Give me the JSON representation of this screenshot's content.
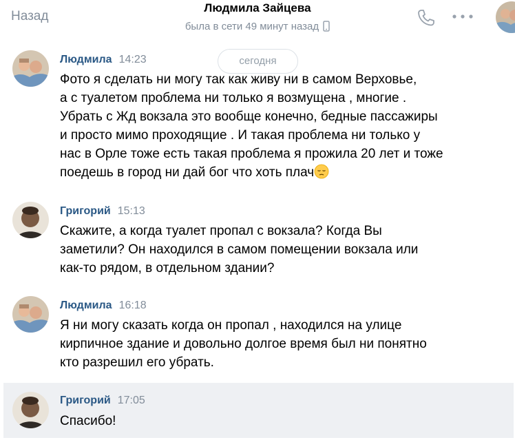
{
  "header": {
    "back_label": "Назад",
    "title": "Людмила Зайцева",
    "status": "была в сети 49 минут назад",
    "icons": [
      "call-icon",
      "more-icon",
      "mobile-icon"
    ]
  },
  "date_separator": "сегодня",
  "messages": [
    {
      "author": "Людмила",
      "time": "14:23",
      "text": "Фото я сделать ни могу так как живу ни в самом Верховье,\nа с туалетом проблема ни только я возмущена , многие .\nУбрать с Жд вокзала это вообще конечно, бедные пассажиры\nи просто мимо проходящие . И такая проблема ни только у\nнас в Орле тоже есть такая проблема я прожила 20 лет и тоже\nпоедешь в город ни дай бог что хоть плач",
      "emoji": "pensive-face"
    },
    {
      "author": "Григорий",
      "time": "15:13",
      "text": "Скажите, а когда туалет пропал с вокзала? Когда Вы\nзаметили? Он находился в самом помещении вокзала или\nкак-то рядом, в отдельном здании?"
    },
    {
      "author": "Людмила",
      "time": "16:18",
      "text": "Я ни могу сказать когда он пропал , находился на улице\nкирпичное здание и довольно долгое время был ни понятно\nкто разрешил его убрать."
    },
    {
      "author": "Григорий",
      "time": "17:05",
      "text": "Спасибо!"
    }
  ],
  "colors": {
    "accent": "#2a5885",
    "secondary_text": "#818c99",
    "highlight_bg": "#eef0f3"
  }
}
